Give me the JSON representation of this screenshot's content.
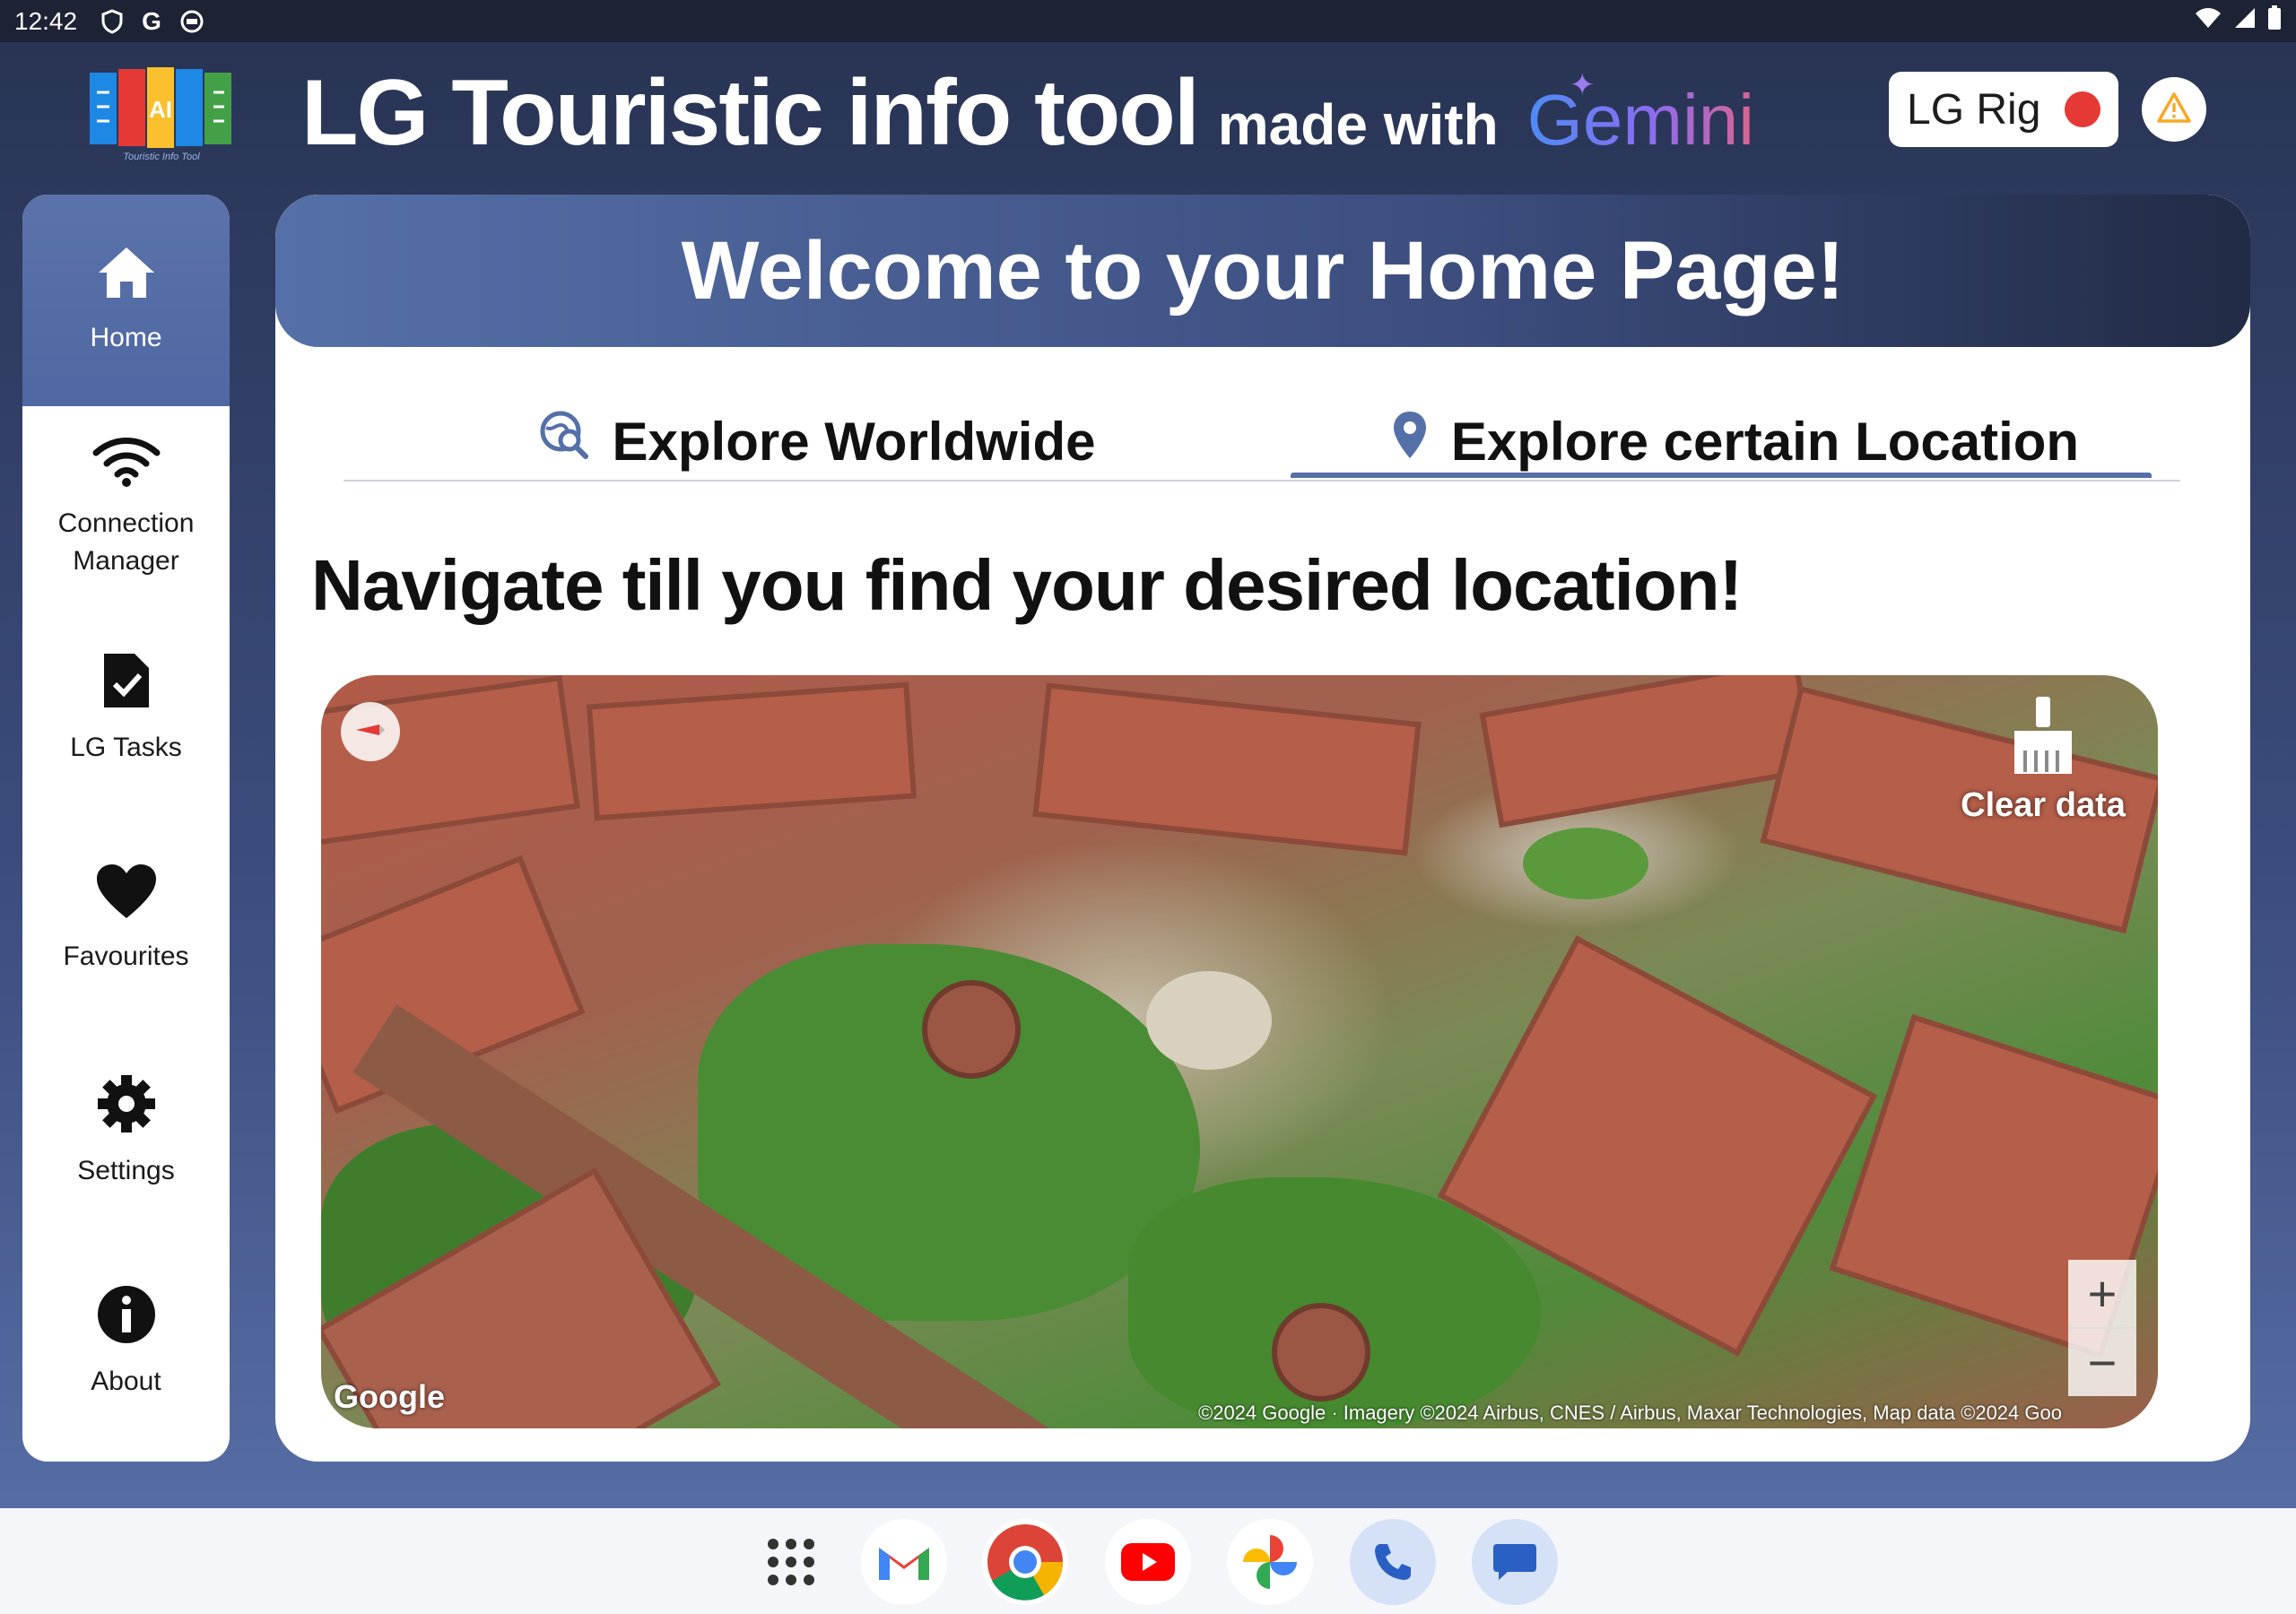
{
  "status_bar": {
    "time": "12:42",
    "left_icons": [
      "shield-icon",
      "google-icon",
      "face-icon"
    ],
    "right_icons": [
      "wifi-icon",
      "cell-signal-icon",
      "battery-icon"
    ]
  },
  "header": {
    "title": "LG Touristic info tool",
    "made_with": "made with",
    "gemini": "Gemini",
    "logo_caption": "Touristic Info Tool",
    "rig_label": "LG Rig",
    "rig_status_color": "#e53935"
  },
  "sidebar": {
    "items": [
      {
        "label": "Home",
        "icon": "home-icon",
        "active": true
      },
      {
        "label": "Connection Manager",
        "icon": "wifi-icon",
        "active": false
      },
      {
        "label": "LG Tasks",
        "icon": "task-file-icon",
        "active": false
      },
      {
        "label": "Favourites",
        "icon": "heart-icon",
        "active": false
      },
      {
        "label": "Settings",
        "icon": "gear-icon",
        "active": false
      },
      {
        "label": "About",
        "icon": "info-icon",
        "active": false
      }
    ]
  },
  "main": {
    "welcome": "Welcome to your Home Page!",
    "tabs": [
      {
        "label": "Explore Worldwide",
        "icon": "globe-search-icon",
        "selected": false
      },
      {
        "label": "Explore certain Location",
        "icon": "location-pin-icon",
        "selected": true
      }
    ],
    "subtitle": "Navigate till you find your desired location!",
    "map": {
      "clear_label": "Clear data",
      "zoom_in": "+",
      "zoom_out": "−",
      "google_logo": "Google",
      "attribution": "©2024 Google · Imagery ©2024 Airbus, CNES / Airbus, Maxar Technologies, Map data ©2024 Goo"
    }
  },
  "dock": {
    "apps": [
      "app-drawer-icon",
      "gmail-icon",
      "chrome-icon",
      "youtube-icon",
      "photos-icon",
      "phone-icon",
      "messages-icon"
    ]
  },
  "colors": {
    "accent": "#5570a8",
    "background_dark": "#283352",
    "status_bar": "#1d2234"
  }
}
